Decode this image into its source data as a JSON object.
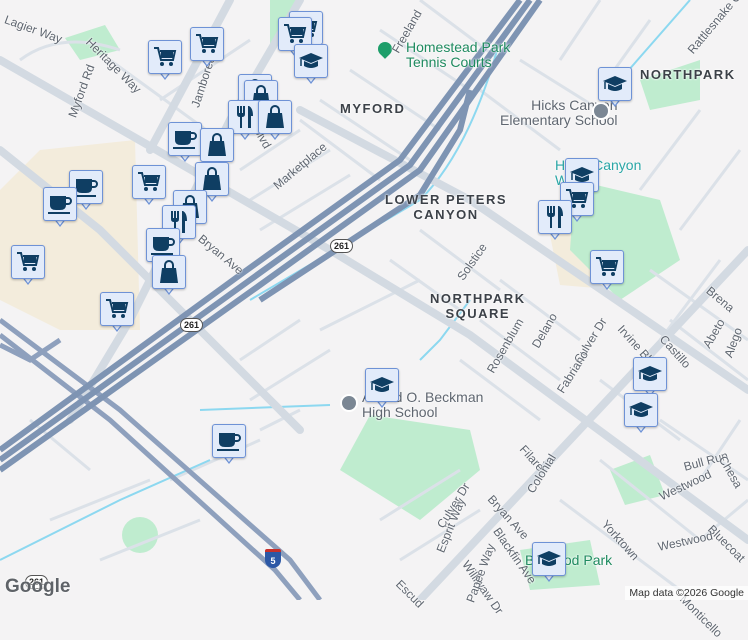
{
  "colors": {
    "background": "#f4f3f4",
    "park": "#bfeccf",
    "commercial": "#f3ecdc",
    "freeway": "#7e94b3",
    "arterial": "#d3dae2",
    "street": "#dbe1e8",
    "water": "#8cd8f0",
    "marker_fill": "#e2ebfa",
    "marker_border": "#6e92d6",
    "marker_icon": "#0f3e63"
  },
  "areas": {
    "myford": "MYFORD",
    "northpark": "NORTHPARK",
    "lower_peters_canyon": [
      "LOWER PETERS",
      "CANYON"
    ],
    "northpark_square": [
      "NORTHPARK",
      "SQUARE"
    ]
  },
  "pois": {
    "homestead": [
      "Homestead Park",
      "Tennis Courts"
    ],
    "hicks_elementary": [
      "Hicks Canyon",
      "Elementary School"
    ],
    "hicks_wash": [
      "Hicks Canyon",
      "Wash"
    ],
    "beckman": [
      "Arnold O. Beckman",
      "High School"
    ],
    "brywood": "Brywood Park"
  },
  "streets": [
    "Lagier Way",
    "Heritage Way",
    "Myford Rd",
    "Jamboree Rd",
    "Irvine Blvd",
    "Marketplace",
    "Bryan Ave",
    "Freeland",
    "Solstice",
    "Rosenblum",
    "Delano",
    "Culver Dr",
    "Irvine Blvd",
    "Castillo",
    "Abeto",
    "Brena",
    "Fabriano",
    "Filare",
    "Colonial",
    "Bryan Ave",
    "Culver Dr",
    "Esprit Way",
    "Blackfin Ave",
    "Williwaw Dr",
    "Yorktown",
    "Westwood",
    "Bull Run",
    "Monticello",
    "Bluecoat",
    "Chesa",
    "Alego",
    "Rattlesnake Canyon",
    "Westwood",
    "Escud",
    "Papee Way"
  ],
  "highways": {
    "sr261_a": "261",
    "sr261_b": "261",
    "sr261_c": "261",
    "i5": "5"
  },
  "markers": [
    "grocery",
    "grocery",
    "grocery",
    "grocery",
    "school",
    "shopping",
    "shopping",
    "restaurant",
    "shopping",
    "cafe",
    "shopping",
    "grocery",
    "shopping",
    "shopping",
    "restaurant",
    "cafe",
    "shopping",
    "cafe",
    "cafe",
    "grocery",
    "grocery",
    "school",
    "school",
    "grocery",
    "restaurant",
    "grocery",
    "school",
    "school",
    "school",
    "cafe",
    "school"
  ],
  "footer": {
    "copyright": "Map data ©2026 Google",
    "logo": "Google"
  }
}
